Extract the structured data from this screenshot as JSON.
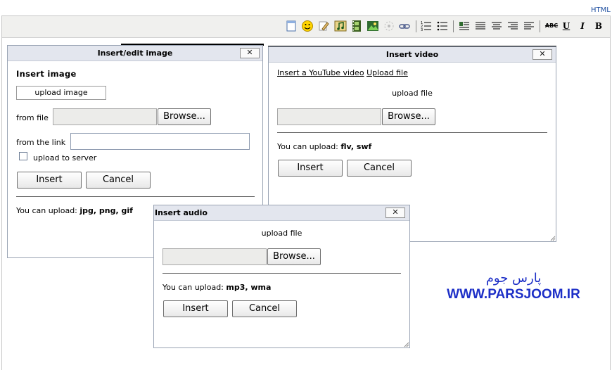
{
  "editor": {
    "html_tab": "HTML"
  },
  "toolbar": {
    "icons": [
      "new-document",
      "smiley",
      "edit-pencil",
      "insert-music",
      "insert-film",
      "insert-image",
      "flash",
      "link",
      "numbered-list",
      "bullet-list",
      "justify-full",
      "justify-left",
      "justify-center",
      "justify-right",
      "justify-left-alt"
    ],
    "spellcheck": "ABC",
    "underline": "U",
    "italic": "I",
    "bold": "B"
  },
  "image_dialog": {
    "title": "Insert/edit image",
    "close": "✕",
    "heading": "Insert image",
    "tab": "upload image",
    "from_file_label": "from file",
    "browse": "Browse...",
    "from_link_label": "from the link",
    "link_value": "",
    "upload_server_label": "upload to server",
    "upload_server_checked": false,
    "insert": "Insert",
    "cancel": "Cancel",
    "note_prefix": "You can upload:",
    "note_types": "jpg, png, gif"
  },
  "video_dialog": {
    "title": "Insert video",
    "close": "✕",
    "tab_youtube": "Insert a YouTube video",
    "tab_upload": "Upload file",
    "upload_label": "upload file",
    "browse": "Browse...",
    "note_prefix": "You can upload:",
    "note_types": "flv, swf",
    "insert": "Insert",
    "cancel": "Cancel"
  },
  "audio_dialog": {
    "title": "Insert audio",
    "close": "✕",
    "upload_label": "upload file",
    "browse": "Browse...",
    "note_prefix": "You can upload:",
    "note_types": "mp3, wma",
    "insert": "Insert",
    "cancel": "Cancel"
  },
  "watermark": {
    "persian": "پارس جوم",
    "url": "WWW.PARSJOOM.IR",
    "color": "#1d2fc7"
  }
}
